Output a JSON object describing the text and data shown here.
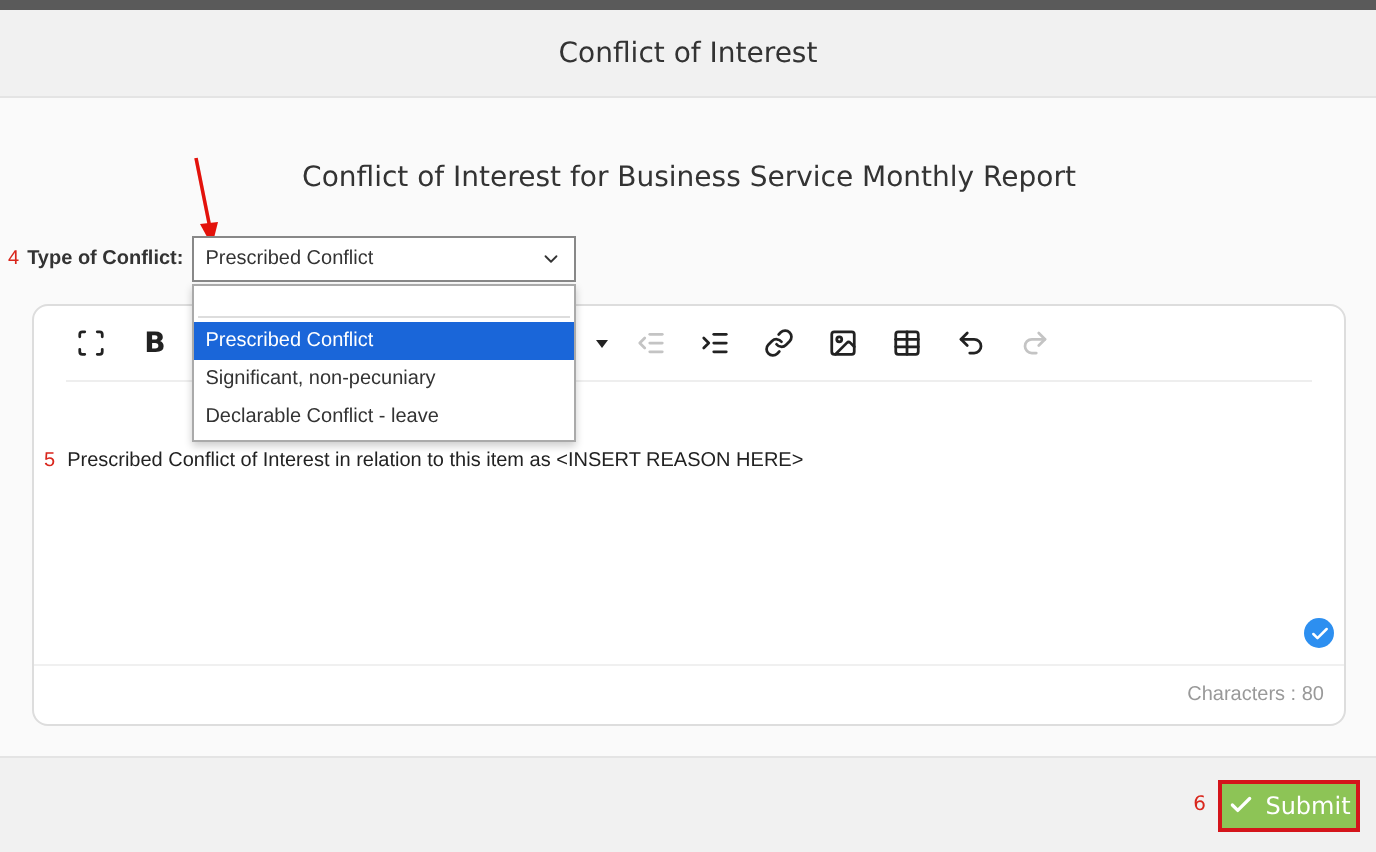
{
  "dialog": {
    "title": "Conflict of Interest"
  },
  "form_title": "Conflict of Interest for Business Service Monthly Report",
  "conflict_field": {
    "step": "4",
    "label": "Type of Conflict:",
    "value": "Prescribed Conflict",
    "expanded": true,
    "options": [
      {
        "label": "Prescribed Conflict",
        "selected": true
      },
      {
        "label": "Significant, non-pecuniary",
        "selected": false
      },
      {
        "label": "Declarable Conflict - leave",
        "selected": false
      }
    ]
  },
  "editor": {
    "toolbar_left": [
      {
        "kind": "fullscreen",
        "disabled": false
      },
      {
        "kind": "bold",
        "label": "B",
        "disabled": false
      }
    ],
    "toolbar_right": [
      {
        "kind": "caret",
        "disabled": false
      },
      {
        "kind": "outdent",
        "disabled": true
      },
      {
        "kind": "indent",
        "disabled": false
      },
      {
        "kind": "link",
        "disabled": false
      },
      {
        "kind": "image",
        "disabled": false
      },
      {
        "kind": "table",
        "disabled": false
      },
      {
        "kind": "undo",
        "disabled": false
      },
      {
        "kind": "redo",
        "disabled": true
      }
    ],
    "step": "5",
    "content": "Prescribed Conflict of Interest in relation to this item as <INSERT REASON HERE>",
    "character_count": "Characters : 80"
  },
  "footer": {
    "step": "6",
    "submit_label": "Submit"
  }
}
